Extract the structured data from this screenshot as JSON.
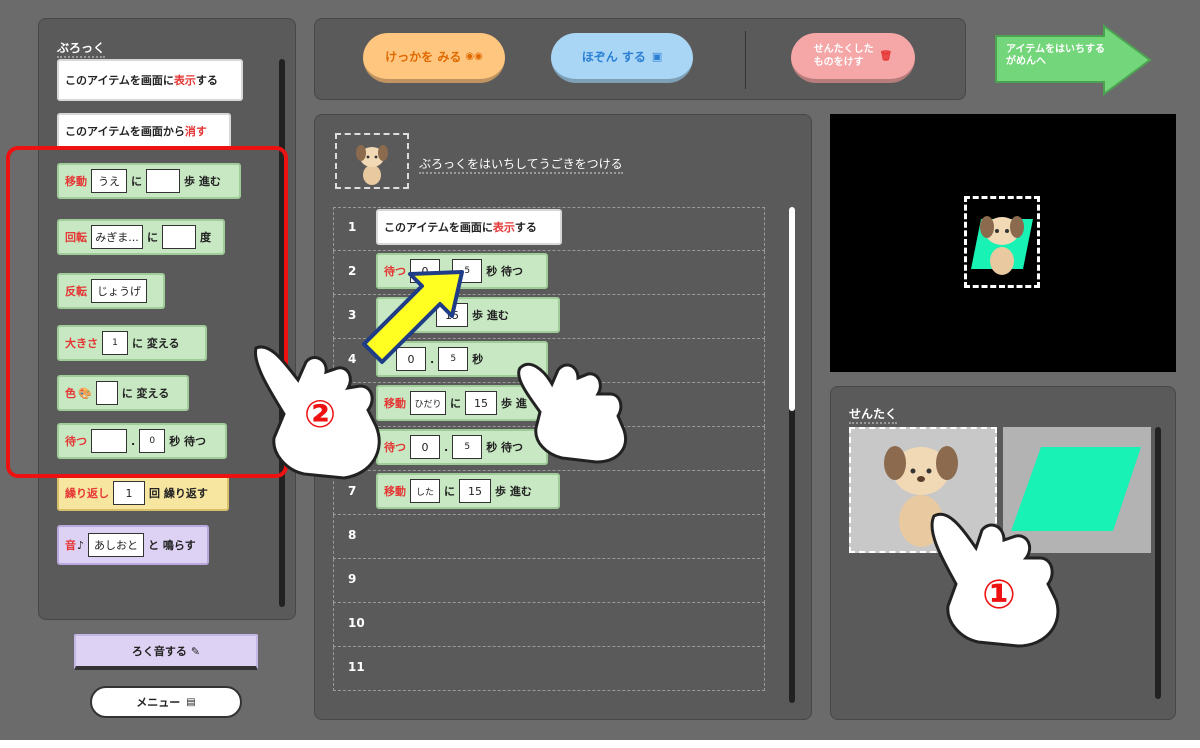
{
  "palette": {
    "title": "ぶろっく",
    "blocks": {
      "show": {
        "prefix": "このアイテムを画面に",
        "accent": "表示",
        "suffix": "する"
      },
      "hide": {
        "prefix": "このアイテムを画面から",
        "accent": "消す"
      },
      "move": {
        "accent": "移動",
        "dir": "うえ",
        "ni": "に",
        "unit": "歩 進む"
      },
      "rotate": {
        "accent": "回転",
        "dir": "みぎま...",
        "ni": "に",
        "unit": "度"
      },
      "flip": {
        "accent": "反転",
        "value": "じょうげ"
      },
      "size": {
        "accent": "大きさ",
        "value": "1",
        "suffix": "に 変える"
      },
      "color": {
        "accent": "色",
        "suffix": "に 変える"
      },
      "wait": {
        "accent": "待つ",
        "dot": ".",
        "value": "0",
        "unit": "秒 待つ"
      },
      "repeat": {
        "accent": "繰り返し",
        "value": "1",
        "suffix": "回 繰り返す"
      },
      "sound": {
        "accent": "音",
        "value": "あしおと",
        "suffix": "と 鳴らす"
      }
    }
  },
  "side_buttons": {
    "record": "ろく音する",
    "menu": "メニュー"
  },
  "toolbar": {
    "run": "けっかを みる",
    "save": "ほぞん する",
    "delete_l1": "せんたくした",
    "delete_l2": "ものをけす",
    "next_l1": "アイテムをはいちする",
    "next_l2": "がめんへ"
  },
  "script": {
    "header": "ぶろっくをはいちしてうごきをつける",
    "rows": [
      {
        "n": "1"
      },
      {
        "n": "2"
      },
      {
        "n": "3"
      },
      {
        "n": "4"
      },
      {
        "n": "5"
      },
      {
        "n": "6"
      },
      {
        "n": "7"
      },
      {
        "n": "8"
      },
      {
        "n": "9"
      },
      {
        "n": "10"
      },
      {
        "n": "11"
      }
    ],
    "r1": {
      "prefix": "このアイテムを画面に",
      "accent": "表示",
      "suffix": "する"
    },
    "r2": {
      "accent": "待つ",
      "a": "0",
      "dot": ".",
      "b": "5",
      "unit": "秒 待つ"
    },
    "r3": {
      "v": "15",
      "unit": "歩 進む"
    },
    "r4": {
      "a": "0",
      "dot": ".",
      "b": "5",
      "unit": "秒"
    },
    "r5": {
      "accent": "移動",
      "dir": "ひだり",
      "ni": "に",
      "v": "15",
      "unit": "歩 進"
    },
    "r6": {
      "accent": "待つ",
      "a": "0",
      "dot": ".",
      "b": "5",
      "unit": "秒 待つ"
    },
    "r7": {
      "accent": "移動",
      "dir": "した",
      "ni": "に",
      "v": "15",
      "unit": "歩 進む"
    }
  },
  "selection": {
    "title": "せんたく"
  },
  "overlay": {
    "hand1": "①",
    "hand2": "②"
  },
  "colors": {
    "accent": "#e53535",
    "run": "#ffc680",
    "save": "#a9d6f5",
    "delete": "#f5a6a6",
    "arrow": "#74d67b",
    "parallelogram": "#19f2b5",
    "highlight": "#ee1111",
    "pointer": "#ffff22"
  }
}
